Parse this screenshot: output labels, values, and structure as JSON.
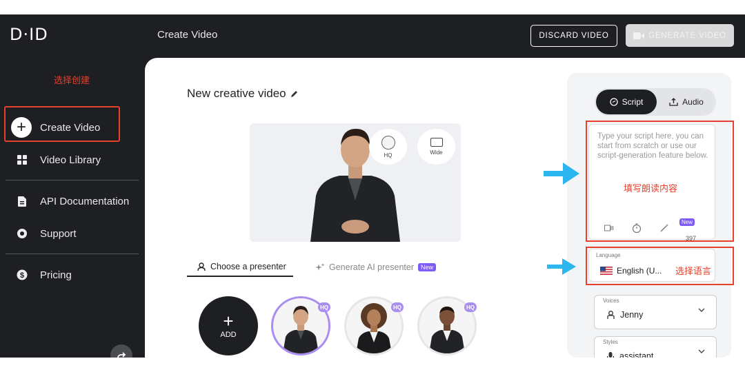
{
  "header": {
    "logo": "D·ID",
    "title": "Create Video",
    "discard_label": "DISCARD VIDEO",
    "generate_label": "GENERATE VIDEO"
  },
  "sidebar": {
    "annotation": "选择创建",
    "items": [
      {
        "label": "Create Video",
        "icon": "plus-icon"
      },
      {
        "label": "Video Library",
        "icon": "grid-icon"
      },
      {
        "label": "API Documentation",
        "icon": "document-icon"
      },
      {
        "label": "Support",
        "icon": "lifebuoy-icon"
      },
      {
        "label": "Pricing",
        "icon": "dollar-icon"
      }
    ]
  },
  "main": {
    "video_title": "New creative video",
    "preview_options": [
      {
        "label": "HQ",
        "icon": "circle-icon"
      },
      {
        "label": "Wide",
        "icon": "rectangle-icon"
      }
    ],
    "tabs": [
      {
        "label": "Choose a presenter",
        "icon": "person-icon",
        "active": true
      },
      {
        "label": "Generate AI presenter",
        "icon": "sparkle-icon",
        "badge": "New"
      }
    ],
    "add_label": "ADD",
    "presenter_badge": "HQ"
  },
  "panel": {
    "tabs": [
      {
        "label": "Script",
        "icon": "script-icon",
        "active": true
      },
      {
        "label": "Audio",
        "icon": "upload-icon"
      }
    ],
    "script_placeholder": "Type your script here, you can start from scratch or use our script-generation feature below.",
    "script_annotation": "填写朗读内容",
    "new_badge": "New",
    "char_count": "397",
    "language_label": "Language",
    "language_value": "English (U...",
    "language_annotation": "选择语言",
    "voices_label": "Voices",
    "voice_value": "Jenny",
    "styles_label": "Styles",
    "style_value": "assistant"
  },
  "colors": {
    "dark": "#1d1f22",
    "annotation_red": "#e8402a",
    "arrow_blue": "#2bb6ee",
    "badge_purple": "#7d5cf5",
    "hq_purple": "#a98df0"
  }
}
